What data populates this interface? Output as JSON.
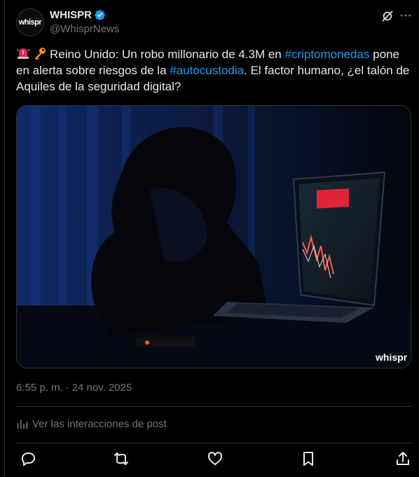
{
  "author": {
    "display_name": "WHISPR",
    "handle": "@WhisprNews",
    "avatar_text": "whispr",
    "verified": true
  },
  "tweet": {
    "text_pre": "Reino Unido: Un robo millonario de 4.3M en ",
    "hashtag1": "#criptomonedas",
    "text_mid": " pone en alerta sobre riesgos de la ",
    "hashtag2": "#autocustodia",
    "text_post": ". El factor humano, ¿el talón de Aquiles de la seguridad digital?",
    "emojis": [
      "rotating-light-icon",
      "key-icon"
    ]
  },
  "media": {
    "watermark": "whispr"
  },
  "timestamp": {
    "time": "6:55 p. m.",
    "separator": "·",
    "date": "24 nov. 2025"
  },
  "analytics_label": "Ver las interacciones de post",
  "colors": {
    "accent": "#1d9bf0",
    "secondary_text": "#71767b",
    "border": "#2f3336",
    "background": "#000000"
  },
  "icons": {
    "grok": "grok-icon",
    "more": "more-icon",
    "reply": "reply-icon",
    "retweet": "retweet-icon",
    "like": "like-icon",
    "bookmark": "bookmark-icon",
    "share": "share-icon",
    "analytics": "analytics-icon"
  }
}
